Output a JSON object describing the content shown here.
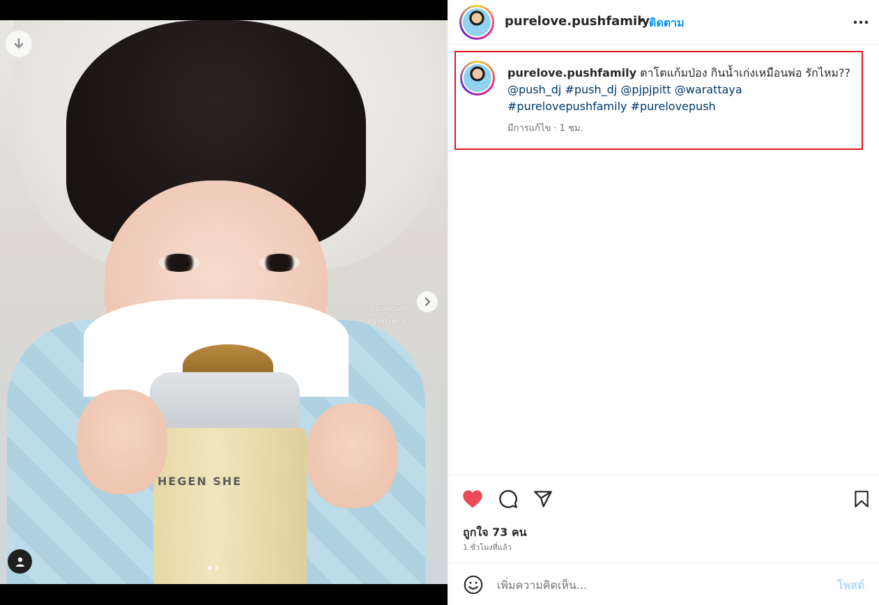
{
  "post": {
    "media": {
      "watermark_line1": "@purelove",
      "watermark_line2": "Pushfamily",
      "bottle_brand": "HEGEN SHE",
      "carousel_count": 2,
      "carousel_active": 1
    },
    "header": {
      "username": "purelove.pushfamily",
      "separator": "•",
      "follow_label": "ติดตาม",
      "more_icon": "more-horizontal-icon"
    },
    "caption": {
      "username": "purelove.pushfamily",
      "text": " ตาโตแก้มป่อง กินน้ำเก่งเหมือนพ่อ รักไหม?? ",
      "mentions": [
        "@push_dj",
        "#push_dj",
        "@pjpjpitt",
        "@warattaya",
        "#purelovepushfamily",
        "#purelovepush"
      ],
      "meta": "มีการแก้ไข · 1 ชม."
    },
    "actions": {
      "like_icon": "heart-filled-icon",
      "comment_icon": "comment-icon",
      "share_icon": "send-icon",
      "save_icon": "bookmark-icon",
      "like_color": "#ed4956"
    },
    "likes_text": "ถูกใจ 73 คน",
    "time_ago": "1 ชั่วโมงที่แล้ว",
    "comment": {
      "placeholder": "เพิ่มความคิดเห็น...",
      "post_label": "โพสต์"
    }
  },
  "colors": {
    "link_blue": "#0095f6",
    "tag_blue": "#00376b",
    "highlight_red": "#e0121b"
  }
}
